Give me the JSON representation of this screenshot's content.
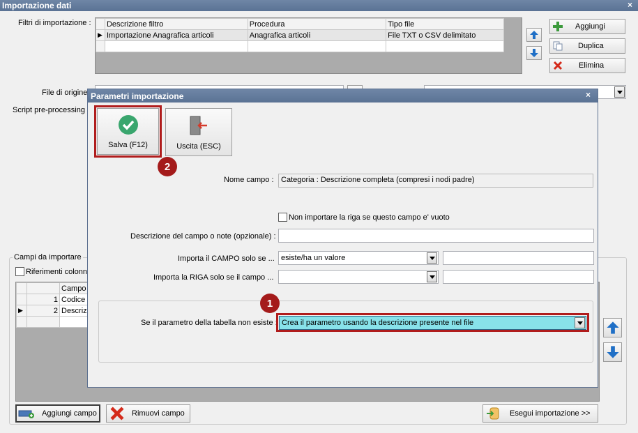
{
  "window": {
    "title": "Importazione dati",
    "close": "×"
  },
  "filters": {
    "label": "Filtri di importazione :",
    "columns": [
      "Descrizione filtro",
      "Procedura",
      "Tipo file"
    ],
    "rows": [
      {
        "marker": "▶",
        "desc": "Importazione Anagrafica articoli",
        "proc": "Anagrafica articoli",
        "type": "File TXT o CSV delimitato"
      }
    ]
  },
  "side_buttons": {
    "add": "Aggiungi",
    "dup": "Duplica",
    "del": "Elimina"
  },
  "source": {
    "file_label": "File di origine",
    "script_label": "Script pre-processing :"
  },
  "fields": {
    "legend": "Campi da importare",
    "ref_columns": "Riferimenti colonne",
    "column": "Campo",
    "rows": [
      {
        "marker": "",
        "num": "1",
        "name": "Codice"
      },
      {
        "marker": "▶",
        "num": "2",
        "name": "Descriz"
      }
    ]
  },
  "bottom": {
    "add_field": "Aggiungi campo",
    "remove_field": "Rimuovi campo",
    "run": "Esegui importazione >>"
  },
  "dialog": {
    "title": "Parametri importazione",
    "close": "×",
    "save": "Salva (F12)",
    "exit": "Uscita (ESC)",
    "field_name_label": "Nome campo :",
    "field_name_value": "Categoria : Descrizione completa (compresi i nodi padre)",
    "skip_empty": "Non importare la riga se questo campo e' vuoto",
    "desc_label": "Descrizione del campo o note (opzionale) :",
    "desc_value": "",
    "import_field_label": "Importa il CAMPO solo se ...",
    "import_field_value": "esiste/ha un valore",
    "import_row_label": "Importa la RIGA solo se il campo ...",
    "import_row_value": "",
    "param_label": "Se il parametro della tabella non esiste :",
    "param_value": "Crea il parametro usando la descrizione presente nel file",
    "badge1": "1",
    "badge2": "2"
  },
  "colors": {
    "accent_red": "#b01c1c",
    "highlight": "#88e2ea",
    "title_bar": "#5f779a"
  }
}
